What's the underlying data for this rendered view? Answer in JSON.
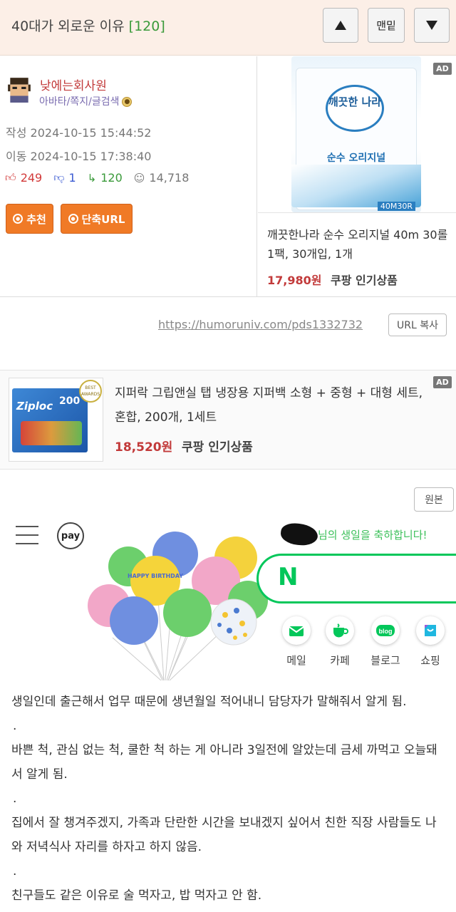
{
  "header": {
    "title": "40대가 외로운 이유",
    "reply_count": "[120]",
    "btn_top_label": "맨밑"
  },
  "author": {
    "name": "낮에는회사원",
    "links": "아바타/쪽지/글검색",
    "written": "작성 2024-10-15 15:44:52",
    "moved": "이동 2024-10-15 17:38:40"
  },
  "stats": {
    "up": "249",
    "down": "1",
    "replies": "120",
    "views": "14,718"
  },
  "actions": {
    "recommend_label": "추천",
    "shorturl_label": "단축URL"
  },
  "ad1": {
    "badge": "AD",
    "brand": "깨끗한 나라",
    "product_line": "순수 오리지널",
    "size": "40M30R",
    "title": "깨끗한나라 순수 오리지널 40m 30롤 1팩, 30개입, 1개",
    "price": "17,980원",
    "tag": "쿠팡 인기상품"
  },
  "url": {
    "link": "https://humoruniv.com/pds1332732",
    "copy_label": "URL 복사"
  },
  "ad2": {
    "badge": "AD",
    "brand": "Ziploc",
    "count": "200",
    "award": "BEST AWARDS",
    "title": "지퍼락 그립앤실 탭 냉장용 지퍼백 소형 + 중형 + 대형 세트, 혼합, 200개, 1세트",
    "price": "18,520원",
    "tag": "쿠팡 인기상품"
  },
  "screenshot": {
    "original_label": "원본",
    "pay_label": "pay",
    "bday_msg": "님의 생일을 축하합니다!",
    "balloon_text": "HAPPY BIRTHDAY",
    "naver_logo": "N",
    "services": [
      {
        "label": "메일",
        "icon": "mail-icon"
      },
      {
        "label": "카페",
        "icon": "cafe-icon"
      },
      {
        "label": "블로그",
        "icon": "blog-icon"
      },
      {
        "label": "쇼핑",
        "icon": "shopping-icon"
      }
    ]
  },
  "body": {
    "p1": "생일인데 출근해서 업무 때문에 생년월일 적어내니 담당자가 말해줘서 알게 됨.",
    "d1": ".",
    "p2": "바쁜 척, 관심 없는 척, 쿨한 척 하는 게 아니라 3일전에 알았는데 금세 까먹고 오늘돼서 알게 됨.",
    "d2": ".",
    "p3": "집에서 잘 챙겨주겠지, 가족과 단란한 시간을 보내겠지 싶어서 친한 직장 사람들도 나와 저녁식사 자리를 하자고 하지 않음.",
    "d3": ".",
    "p4": "친구들도 같은 이유로 술 먹자고, 밥 먹자고 안 함."
  },
  "colors": {
    "header_bg": "#fcefe7",
    "accent_orange": "#f07a26",
    "naver_green": "#03c75a",
    "price_red": "#c23a3a"
  }
}
